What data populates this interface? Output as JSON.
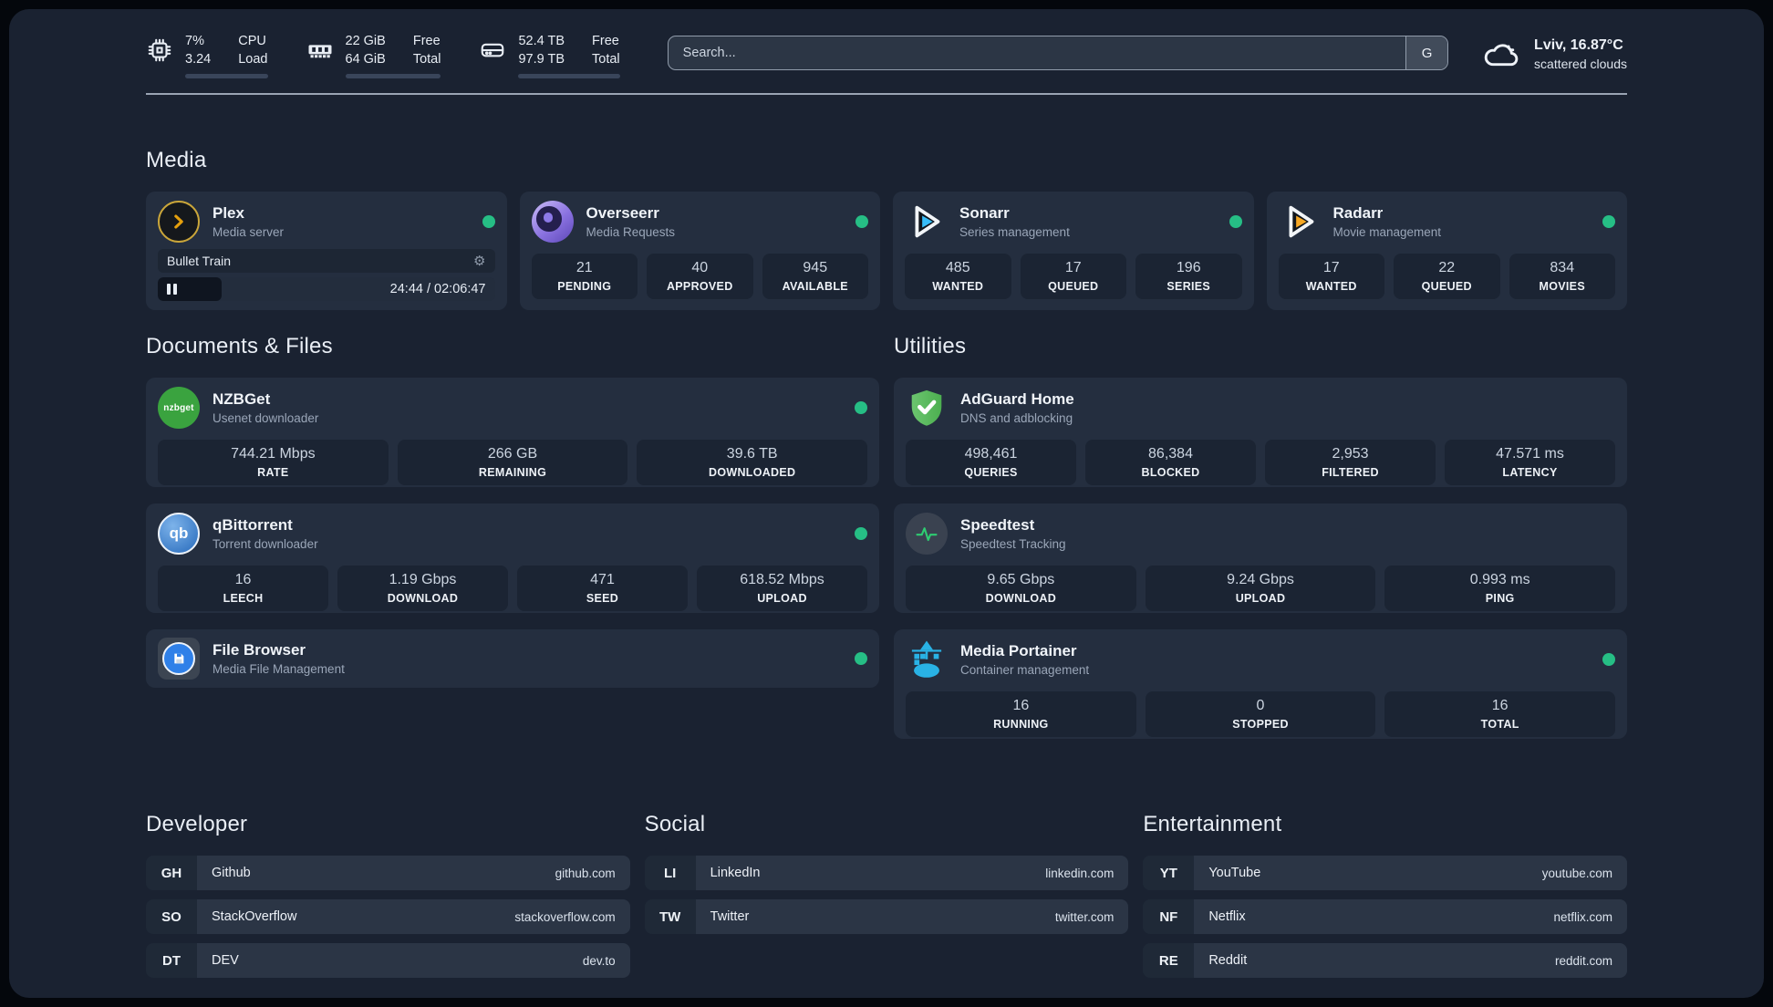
{
  "status_bar": {
    "cpu": {
      "value_top": "7%",
      "value_bottom": "3.24",
      "label_top": "CPU",
      "label_bottom": "Load",
      "progress": "8%"
    },
    "memory": {
      "value_top": "22 GiB",
      "value_bottom": "64 GiB",
      "label_top": "Free",
      "label_bottom": "Total",
      "progress": "66%"
    },
    "disk": {
      "value_top": "52.4 TB",
      "value_bottom": "97.9 TB",
      "label_top": "Free",
      "label_bottom": "Total",
      "progress": "55%"
    },
    "search": {
      "placeholder": "Search...",
      "engine_label": "G"
    },
    "weather": {
      "location": "Lviv, 16.87°C",
      "condition": "scattered clouds"
    }
  },
  "sections": {
    "media": {
      "title": "Media",
      "apps": [
        {
          "name": "Plex",
          "description": "Media server",
          "online": true,
          "now_playing": {
            "title": "Bullet Train",
            "time": "24:44 / 02:06:47",
            "progress": "19%",
            "state": "paused"
          }
        },
        {
          "name": "Overseerr",
          "description": "Media Requests",
          "online": true,
          "stats": [
            {
              "value": "21",
              "label": "PENDING"
            },
            {
              "value": "40",
              "label": "APPROVED"
            },
            {
              "value": "945",
              "label": "AVAILABLE"
            }
          ]
        },
        {
          "name": "Sonarr",
          "description": "Series management",
          "online": true,
          "stats": [
            {
              "value": "485",
              "label": "WANTED"
            },
            {
              "value": "17",
              "label": "QUEUED"
            },
            {
              "value": "196",
              "label": "SERIES"
            }
          ]
        },
        {
          "name": "Radarr",
          "description": "Movie management",
          "online": true,
          "stats": [
            {
              "value": "17",
              "label": "WANTED"
            },
            {
              "value": "22",
              "label": "QUEUED"
            },
            {
              "value": "834",
              "label": "MOVIES"
            }
          ]
        }
      ]
    },
    "documents": {
      "title": "Documents & Files",
      "apps": [
        {
          "name": "NZBGet",
          "description": "Usenet downloader",
          "online": true,
          "stats": [
            {
              "value": "744.21 Mbps",
              "label": "RATE"
            },
            {
              "value": "266 GB",
              "label": "REMAINING"
            },
            {
              "value": "39.6 TB",
              "label": "DOWNLOADED"
            }
          ]
        },
        {
          "name": "qBittorrent",
          "description": "Torrent downloader",
          "online": true,
          "stats": [
            {
              "value": "16",
              "label": "LEECH"
            },
            {
              "value": "1.19 Gbps",
              "label": "DOWNLOAD"
            },
            {
              "value": "471",
              "label": "SEED"
            },
            {
              "value": "618.52 Mbps",
              "label": "UPLOAD"
            }
          ]
        },
        {
          "name": "File Browser",
          "description": "Media File Management",
          "online": true
        }
      ]
    },
    "utilities": {
      "title": "Utilities",
      "apps": [
        {
          "name": "AdGuard Home",
          "description": "DNS and adblocking",
          "online": false,
          "stats": [
            {
              "value": "498,461",
              "label": "QUERIES"
            },
            {
              "value": "86,384",
              "label": "BLOCKED"
            },
            {
              "value": "2,953",
              "label": "FILTERED"
            },
            {
              "value": "47.571 ms",
              "label": "LATENCY"
            }
          ]
        },
        {
          "name": "Speedtest",
          "description": "Speedtest Tracking",
          "online": false,
          "stats": [
            {
              "value": "9.65 Gbps",
              "label": "DOWNLOAD"
            },
            {
              "value": "9.24 Gbps",
              "label": "UPLOAD"
            },
            {
              "value": "0.993 ms",
              "label": "PING"
            }
          ]
        },
        {
          "name": "Media Portainer",
          "description": "Container management",
          "online": true,
          "stats": [
            {
              "value": "16",
              "label": "RUNNING"
            },
            {
              "value": "0",
              "label": "STOPPED"
            },
            {
              "value": "16",
              "label": "TOTAL"
            }
          ]
        }
      ]
    }
  },
  "bookmarks": {
    "groups": [
      {
        "title": "Developer",
        "items": [
          {
            "abbr": "GH",
            "name": "Github",
            "url": "github.com"
          },
          {
            "abbr": "SO",
            "name": "StackOverflow",
            "url": "stackoverflow.com"
          },
          {
            "abbr": "DT",
            "name": "DEV",
            "url": "dev.to"
          }
        ]
      },
      {
        "title": "Social",
        "items": [
          {
            "abbr": "LI",
            "name": "LinkedIn",
            "url": "linkedin.com"
          },
          {
            "abbr": "TW",
            "name": "Twitter",
            "url": "twitter.com"
          }
        ]
      },
      {
        "title": "Entertainment",
        "items": [
          {
            "abbr": "YT",
            "name": "YouTube",
            "url": "youtube.com"
          },
          {
            "abbr": "NF",
            "name": "Netflix",
            "url": "netflix.com"
          },
          {
            "abbr": "RE",
            "name": "Reddit",
            "url": "reddit.com"
          }
        ]
      }
    ]
  },
  "icons": {
    "cpu-icon": "chip outline",
    "memory-icon": "ram stick",
    "disk-icon": "drive box",
    "search-engine-badge": "G",
    "cloud-icon": "cloud outline",
    "gear-icon": "⚙",
    "pause-icon": "❚❚",
    "status-dot": "●"
  },
  "colors": {
    "accent_green": "#26be85",
    "plex_amber": "#e5a00d",
    "sonarr_blue": "#38bdf8",
    "radarr_amber": "#f7a824",
    "nzbget_green": "#3aa33f",
    "qbittorrent_blue": "#4e8fd5",
    "filebrowser_blue": "#2f80e8",
    "adguard_green": "#57b45c",
    "speedtest_green": "#2ecc71",
    "portainer_blue": "#29b2e5"
  }
}
